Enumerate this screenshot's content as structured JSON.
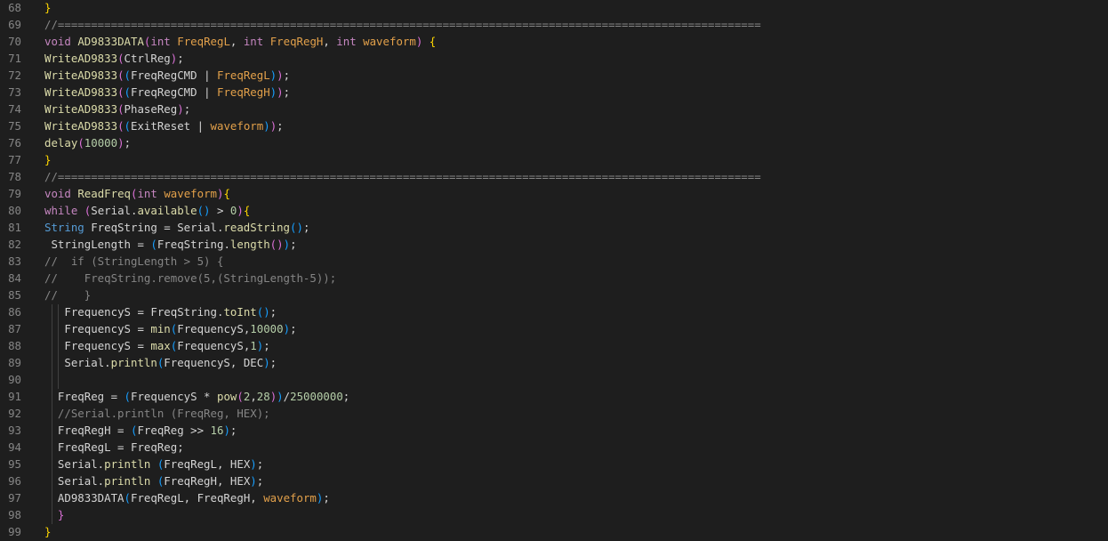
{
  "colors": {
    "background": "#1e1e1e",
    "line_number": "#858585",
    "keyword": "#c586c0",
    "function": "#dcdcaa",
    "parameter": "#e2a04a",
    "number": "#b5cea8",
    "comment": "#858585",
    "brace": "#ffd700",
    "paren": "#da70d6",
    "paren_inner": "#179fff",
    "type_string": "#569cd6",
    "default_text": "#d4d4d4"
  },
  "lines": [
    {
      "num": "68",
      "tokens": [
        [
          "brace",
          "}"
        ]
      ]
    },
    {
      "num": "69",
      "tokens": [
        [
          "cmt",
          "//=========================================================================================================="
        ]
      ]
    },
    {
      "num": "70",
      "tokens": [
        [
          "kw",
          "void "
        ],
        [
          "fn",
          "AD9833DATA"
        ],
        [
          "paren",
          "("
        ],
        [
          "kw",
          "int "
        ],
        [
          "paramO",
          "FreqRegL"
        ],
        [
          "punc",
          ", "
        ],
        [
          "kw",
          "int "
        ],
        [
          "paramO",
          "FreqRegH"
        ],
        [
          "punc",
          ", "
        ],
        [
          "kw",
          "int "
        ],
        [
          "paramO",
          "waveform"
        ],
        [
          "paren",
          ")"
        ],
        [
          "punc",
          " "
        ],
        [
          "brace",
          "{"
        ]
      ]
    },
    {
      "num": "71",
      "tokens": [
        [
          "fnA",
          "WriteAD9833"
        ],
        [
          "paren",
          "("
        ],
        [
          "var",
          "CtrlReg"
        ],
        [
          "paren",
          ")"
        ],
        [
          "punc",
          ";"
        ]
      ]
    },
    {
      "num": "72",
      "tokens": [
        [
          "fnA",
          "WriteAD9833"
        ],
        [
          "paren",
          "("
        ],
        [
          "paren2",
          "("
        ],
        [
          "var",
          "FreqRegCMD "
        ],
        [
          "punc",
          "| "
        ],
        [
          "paramO",
          "FreqRegL"
        ],
        [
          "paren2",
          ")"
        ],
        [
          "paren",
          ")"
        ],
        [
          "punc",
          ";"
        ]
      ]
    },
    {
      "num": "73",
      "tokens": [
        [
          "fnA",
          "WriteAD9833"
        ],
        [
          "paren",
          "("
        ],
        [
          "paren2",
          "("
        ],
        [
          "var",
          "FreqRegCMD "
        ],
        [
          "punc",
          "| "
        ],
        [
          "paramO",
          "FreqRegH"
        ],
        [
          "paren2",
          ")"
        ],
        [
          "paren",
          ")"
        ],
        [
          "punc",
          ";"
        ]
      ]
    },
    {
      "num": "74",
      "tokens": [
        [
          "fnA",
          "WriteAD9833"
        ],
        [
          "paren",
          "("
        ],
        [
          "var",
          "PhaseReg"
        ],
        [
          "paren",
          ")"
        ],
        [
          "punc",
          ";"
        ]
      ]
    },
    {
      "num": "75",
      "tokens": [
        [
          "fnA",
          "WriteAD9833"
        ],
        [
          "paren",
          "("
        ],
        [
          "paren2",
          "("
        ],
        [
          "var",
          "ExitReset "
        ],
        [
          "punc",
          "| "
        ],
        [
          "paramO",
          "waveform"
        ],
        [
          "paren2",
          ")"
        ],
        [
          "paren",
          ")"
        ],
        [
          "punc",
          ";"
        ]
      ]
    },
    {
      "num": "76",
      "tokens": [
        [
          "fnA",
          "delay"
        ],
        [
          "paren",
          "("
        ],
        [
          "num",
          "10000"
        ],
        [
          "paren",
          ")"
        ],
        [
          "punc",
          ";"
        ]
      ]
    },
    {
      "num": "77",
      "tokens": [
        [
          "brace",
          "}"
        ]
      ]
    },
    {
      "num": "78",
      "tokens": [
        [
          "cmt",
          "//=========================================================================================================="
        ]
      ]
    },
    {
      "num": "79",
      "tokens": [
        [
          "kw",
          "void "
        ],
        [
          "fn",
          "ReadFreq"
        ],
        [
          "paren",
          "("
        ],
        [
          "kw",
          "int "
        ],
        [
          "paramO",
          "waveform"
        ],
        [
          "paren",
          ")"
        ],
        [
          "brace",
          "{"
        ]
      ]
    },
    {
      "num": "80",
      "tokens": [
        [
          "kw",
          "while "
        ],
        [
          "paren",
          "("
        ],
        [
          "var",
          "Serial."
        ],
        [
          "fnA",
          "available"
        ],
        [
          "paren2",
          "()"
        ],
        [
          "punc",
          " > "
        ],
        [
          "num",
          "0"
        ],
        [
          "paren",
          ")"
        ],
        [
          "brace",
          "{"
        ]
      ]
    },
    {
      "num": "81",
      "tokens": [
        [
          "str",
          "String "
        ],
        [
          "var",
          "FreqString = Serial."
        ],
        [
          "fnA",
          "readString"
        ],
        [
          "paren2",
          "()"
        ],
        [
          "punc",
          ";"
        ]
      ]
    },
    {
      "num": "82",
      "tokens": [
        [
          "punc",
          " "
        ],
        [
          "var",
          "StringLength = "
        ],
        [
          "paren2",
          "("
        ],
        [
          "var",
          "FreqString."
        ],
        [
          "fnA",
          "length"
        ],
        [
          "paren",
          "()"
        ],
        [
          "paren2",
          ")"
        ],
        [
          "punc",
          ";"
        ]
      ]
    },
    {
      "num": "83",
      "tokens": [
        [
          "cmt",
          "//  if (StringLength > 5) {"
        ]
      ]
    },
    {
      "num": "84",
      "tokens": [
        [
          "cmt",
          "//    FreqString.remove(5,(StringLength-5));"
        ]
      ]
    },
    {
      "num": "85",
      "tokens": [
        [
          "cmt",
          "//    }"
        ]
      ]
    },
    {
      "num": "86",
      "tokens": [
        [
          "punc",
          "   "
        ],
        [
          "var",
          "FrequencyS = FreqString."
        ],
        [
          "fnA",
          "toInt"
        ],
        [
          "paren2",
          "()"
        ],
        [
          "punc",
          ";"
        ]
      ]
    },
    {
      "num": "87",
      "tokens": [
        [
          "punc",
          "   "
        ],
        [
          "var",
          "FrequencyS = "
        ],
        [
          "fnA",
          "min"
        ],
        [
          "paren2",
          "("
        ],
        [
          "var",
          "FrequencyS,"
        ],
        [
          "num",
          "10000"
        ],
        [
          "paren2",
          ")"
        ],
        [
          "punc",
          ";"
        ]
      ]
    },
    {
      "num": "88",
      "tokens": [
        [
          "punc",
          "   "
        ],
        [
          "var",
          "FrequencyS = "
        ],
        [
          "fnA",
          "max"
        ],
        [
          "paren2",
          "("
        ],
        [
          "var",
          "FrequencyS,"
        ],
        [
          "num",
          "1"
        ],
        [
          "paren2",
          ")"
        ],
        [
          "punc",
          ";"
        ]
      ]
    },
    {
      "num": "89",
      "tokens": [
        [
          "punc",
          "   "
        ],
        [
          "var",
          "Serial."
        ],
        [
          "fnA",
          "println"
        ],
        [
          "paren2",
          "("
        ],
        [
          "var",
          "FrequencyS, DEC"
        ],
        [
          "paren2",
          ")"
        ],
        [
          "punc",
          ";"
        ]
      ]
    },
    {
      "num": "90",
      "tokens": []
    },
    {
      "num": "91",
      "tokens": [
        [
          "punc",
          "  "
        ],
        [
          "var",
          "FreqReg = "
        ],
        [
          "paren2",
          "("
        ],
        [
          "var",
          "FrequencyS * "
        ],
        [
          "fnA",
          "pow"
        ],
        [
          "paren",
          "("
        ],
        [
          "num",
          "2"
        ],
        [
          "punc",
          ","
        ],
        [
          "num",
          "28"
        ],
        [
          "paren",
          ")"
        ],
        [
          "paren2",
          ")"
        ],
        [
          "punc",
          "/"
        ],
        [
          "num",
          "25000000"
        ],
        [
          "punc",
          ";"
        ]
      ]
    },
    {
      "num": "92",
      "tokens": [
        [
          "punc",
          "  "
        ],
        [
          "cmt",
          "//Serial.println (FreqReg, HEX);"
        ]
      ]
    },
    {
      "num": "93",
      "tokens": [
        [
          "punc",
          "  "
        ],
        [
          "var",
          "FreqRegH = "
        ],
        [
          "paren2",
          "("
        ],
        [
          "var",
          "FreqReg >> "
        ],
        [
          "num",
          "16"
        ],
        [
          "paren2",
          ")"
        ],
        [
          "punc",
          ";"
        ]
      ]
    },
    {
      "num": "94",
      "tokens": [
        [
          "punc",
          "  "
        ],
        [
          "var",
          "FreqRegL = FreqReg;"
        ]
      ]
    },
    {
      "num": "95",
      "tokens": [
        [
          "punc",
          "  "
        ],
        [
          "var",
          "Serial."
        ],
        [
          "fnA",
          "println "
        ],
        [
          "paren2",
          "("
        ],
        [
          "var",
          "FreqRegL, HEX"
        ],
        [
          "paren2",
          ")"
        ],
        [
          "punc",
          ";"
        ]
      ]
    },
    {
      "num": "96",
      "tokens": [
        [
          "punc",
          "  "
        ],
        [
          "var",
          "Serial."
        ],
        [
          "fnA",
          "println "
        ],
        [
          "paren2",
          "("
        ],
        [
          "var",
          "FreqRegH, HEX"
        ],
        [
          "paren2",
          ")"
        ],
        [
          "punc",
          ";"
        ]
      ]
    },
    {
      "num": "97",
      "tokens": [
        [
          "punc",
          "  "
        ],
        [
          "var",
          "AD9833DATA"
        ],
        [
          "paren2",
          "("
        ],
        [
          "var",
          "FreqRegL, FreqRegH, "
        ],
        [
          "paramO",
          "waveform"
        ],
        [
          "paren2",
          ")"
        ],
        [
          "punc",
          ";"
        ]
      ]
    },
    {
      "num": "98",
      "tokens": [
        [
          "punc",
          "  "
        ],
        [
          "paren",
          "}"
        ]
      ]
    },
    {
      "num": "99",
      "tokens": [
        [
          "brace",
          "}"
        ]
      ]
    }
  ]
}
